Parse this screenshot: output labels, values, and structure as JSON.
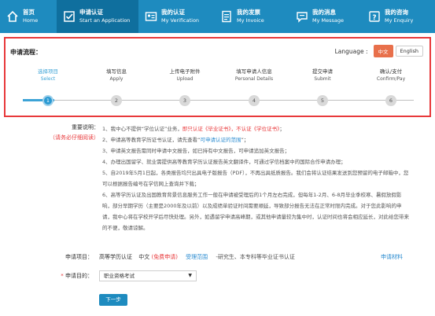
{
  "nav": {
    "items": [
      {
        "zh": "首页",
        "en": "Home",
        "icon": "home-icon"
      },
      {
        "zh": "申请认证",
        "en": "Start an Application",
        "icon": "checkbox-icon"
      },
      {
        "zh": "我的认证",
        "en": "My Verification",
        "icon": "id-card-icon"
      },
      {
        "zh": "我的发票",
        "en": "My Invoice",
        "icon": "invoice-icon"
      },
      {
        "zh": "我的消息",
        "en": "My Message",
        "icon": "message-icon"
      },
      {
        "zh": "我的咨询",
        "en": "My Enquiry",
        "icon": "question-icon"
      }
    ],
    "active_index": 1
  },
  "process": {
    "title": "申请流程：",
    "language_label": "Language :",
    "lang_zh": "中文",
    "lang_en": "English",
    "steps": [
      {
        "zh": "选择项目",
        "en": "Select",
        "num": "1"
      },
      {
        "zh": "填写信息",
        "en": "Apply",
        "num": "2"
      },
      {
        "zh": "上传电子附件",
        "en": "Upload",
        "num": "3"
      },
      {
        "zh": "填写申请人信息",
        "en": "Personal Details",
        "num": "4"
      },
      {
        "zh": "提交申请",
        "en": "Submit",
        "num": "5"
      },
      {
        "zh": "确认/支付",
        "en": "Confirm/Pay",
        "num": "6"
      }
    ],
    "current_step": 1
  },
  "notes": {
    "label": "重要说明：",
    "sublabel": "（请务必仔细阅读）",
    "n1_pre": "1、我中心不提供“学位认证”业务，",
    "n1_red": "即只认证《毕业证书》，不认证《学位证书》",
    "n1_post": "；",
    "n2_pre": "2、申请高等教育学历证书认证，请先查看“",
    "n2_link": "可申请认证的范围",
    "n2_post": "”；",
    "n3": "3、申请英文报告需同时申请中文报告，如已持有中文报告，可申请追加英文报告；",
    "n4": "4、办理出国留学、就业需提供高等教育学历认证报告英文翻译件，可通过学信档案中的国际合作申请办理；",
    "n5": "5、自2019年5月1日起，各类报告均只出具电子版报告（PDF），不再出具纸质报告。我们会将认证结果发送到您预留的电子邮箱中，您可以根据报告编号在学信网上查询并下载；",
    "n6": "6、高等学历认证及出国教育背景信息服务工作一般在申请被受理后的1个月左右完成，但每年1-2月、6-8月毕业季校寒、暑假放假影响，部分早期学历（主要是2000年及以前）以及成绩单验证时间需要顺延，导致部分报告无法在正常时限内完成。对于您此影响的申请，我中心将在学校开学后尽快处理。另外，如遇留学申请高峰期，或其他申请量较为集中时，认证时间也将会相应延长，对此给您带来的不便，敬请谅解。"
  },
  "form": {
    "project_label": "申请项目：",
    "project_value": "高等学历认证",
    "project_lang": "中文",
    "project_free": "(免费申请)",
    "project_scope": "受理范围",
    "project_desc": "-研究生、本专科等毕业证书认证",
    "materials_link": "申请材料",
    "purpose_label": "申请目的：",
    "purpose_star": "*",
    "purpose_value": "职业资格考试",
    "next_button": "下一步"
  },
  "colors": {
    "nav_bg": "#1e8bbf",
    "nav_active": "#0f6f9e",
    "highlight_border": "#e8393b",
    "accent_blue": "#2a9ad3",
    "lang_active": "#e8704b"
  }
}
